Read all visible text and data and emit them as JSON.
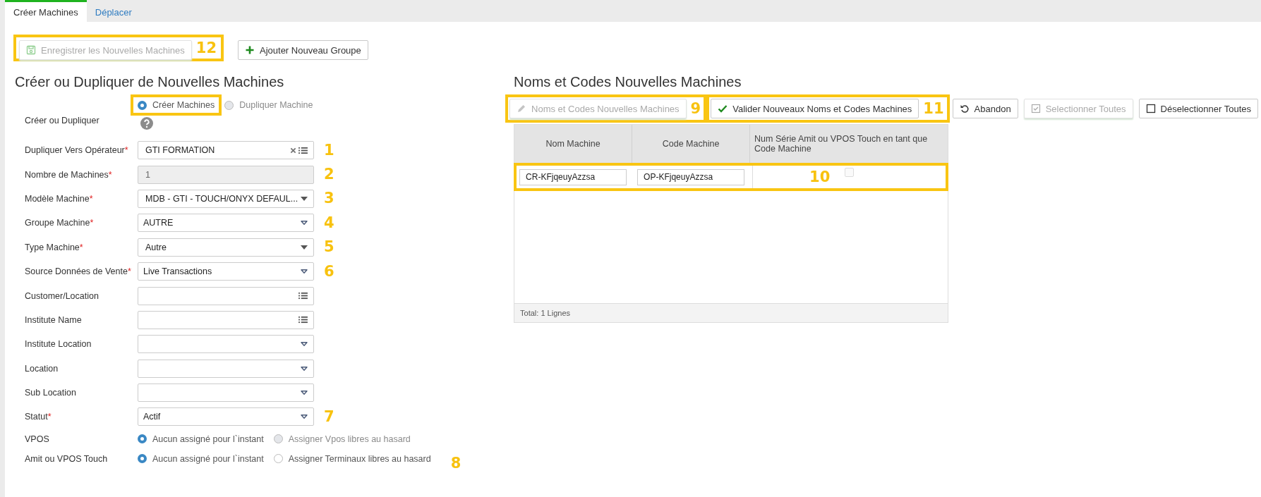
{
  "tabs": [
    {
      "label": "Créer Machines",
      "selected": true
    },
    {
      "label": "Déplacer",
      "selected": false
    }
  ],
  "actions": [
    {
      "label": "Enregistrer les Nouvelles Machines",
      "kind": "save",
      "disabled": true,
      "highlighted": true,
      "callout": "12"
    },
    {
      "label": "Ajouter Nouveau Groupe",
      "kind": "plus",
      "disabled": false,
      "highlighted": false
    }
  ],
  "form": {
    "title": "Créer ou Dupliquer de Nouvelles Machines",
    "rows": [
      {
        "kind": "radio",
        "label": "Créer ou Dupliquer",
        "help": true,
        "options": [
          {
            "label": "Créer Machines",
            "selected": true,
            "disabled": false,
            "highlighted": true
          },
          {
            "label": "Dupliquer Machine",
            "selected": false,
            "disabled": true,
            "highlighted": false
          }
        ]
      },
      {
        "kind": "lookup",
        "label": "Dupliquer Vers Opérateur",
        "required": "*",
        "value": "GTI FORMATION",
        "clearable": true,
        "callout": "1"
      },
      {
        "kind": "text",
        "label": "Nombre de Machines",
        "required": "*",
        "value": "1",
        "disabled": true,
        "callout": "2"
      },
      {
        "kind": "dropdown",
        "label": "Modèle Machine",
        "required": "*",
        "value": "MDB - GTI - TOUCH/ONYX DEFAUL...",
        "callout": "3"
      },
      {
        "kind": "combobox",
        "label": "Groupe Machine",
        "required": "*",
        "value": "AUTRE",
        "callout": "4"
      },
      {
        "kind": "dropdown",
        "label": "Type Machine",
        "required": "*",
        "value": "Autre",
        "callout": "5"
      },
      {
        "kind": "combobox",
        "label": "Source Données de Vente",
        "required": "*",
        "value": "Live Transactions",
        "callout": "6"
      },
      {
        "kind": "lookup",
        "label": "Customer/Location"
      },
      {
        "kind": "lookup",
        "label": "Institute Name"
      },
      {
        "kind": "combobox",
        "label": "Institute Location"
      },
      {
        "kind": "combobox",
        "label": "Location"
      },
      {
        "kind": "combobox",
        "label": "Sub Location"
      },
      {
        "kind": "combobox",
        "label": "Statut",
        "required": "*",
        "value": "Actif",
        "callout": "7"
      },
      {
        "kind": "radio",
        "label": "VPOS",
        "options": [
          {
            "label": "Aucun assigné pour l`instant",
            "selected": true,
            "disabled": false,
            "highlighted": false
          },
          {
            "label": "Assigner Vpos libres au hasard",
            "selected": false,
            "disabled": true,
            "highlighted": false
          }
        ]
      },
      {
        "kind": "radio",
        "label": "Amit ou VPOS Touch",
        "callout": "8",
        "options": [
          {
            "label": "Aucun assigné pour l`instant",
            "selected": true,
            "disabled": false,
            "highlighted": false
          },
          {
            "label": "Assigner Terminaux libres au hasard",
            "selected": false,
            "disabled": false,
            "highlighted": false
          }
        ]
      }
    ]
  },
  "names": {
    "title": "Noms et Codes Nouvelles Machines",
    "toolbar": [
      {
        "label": "Noms et Codes Nouvelles Machines",
        "kind": "pencil",
        "disabled": true,
        "highlighted": true,
        "callout": "9"
      },
      {
        "label": "Valider Nouveaux Noms et Codes Machines",
        "kind": "check",
        "disabled": false,
        "highlighted": true,
        "callout": "11"
      },
      {
        "label": "Abandon",
        "kind": "undo",
        "disabled": false,
        "highlighted": false
      },
      {
        "label": "Selectionner Toutes",
        "kind": "checked-box",
        "disabled": true,
        "highlighted": false
      },
      {
        "label": "Déselectionner Toutes",
        "kind": "empty-box",
        "disabled": false,
        "highlighted": false
      }
    ],
    "columns": [
      "Nom Machine",
      "Code Machine",
      "Num Série Amit ou VPOS Touch en tant que Code Machine"
    ],
    "rows": [
      {
        "name": "CR-KFjqeuyAzzsa",
        "code": "OP-KFjqeuyAzzsa",
        "serial_as_code": false,
        "highlighted": true,
        "callout": "10"
      }
    ],
    "footer": "Total: 1 Lignes"
  }
}
